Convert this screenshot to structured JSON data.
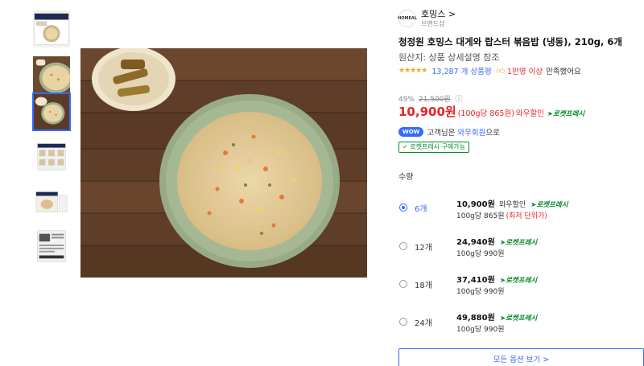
{
  "brand": {
    "name": "호밍스 >",
    "sub": "브랜드샵"
  },
  "product": {
    "title": "청정원 호밍스 대게와 랍스터 볶음밥 (냉동), 210g, 6개",
    "origin": "원산지: 상품 상세설명 참조",
    "rating": {
      "stars": "★★★★★",
      "review_count": "13,287 개 상품평",
      "satisfy_icon": "thumbs-up-icon",
      "satisfy_count": "1만명 이상",
      "satisfy_text": "만족했어요"
    },
    "discount": {
      "percent": "49%",
      "original": "21,500원",
      "info_icon": "ⓘ"
    },
    "price": {
      "main": "10,900원",
      "unit": "(100g당 865원)",
      "wow_label": "와우할인",
      "rocket": "로켓프레시"
    },
    "wow": {
      "badge": "WOW",
      "prefix": "고객님은 ",
      "link": "와우회원",
      "suffix": "으로"
    },
    "fresh_button": "✓ 로켓프레시 구매가능"
  },
  "quantity": {
    "label": "수량",
    "options": [
      {
        "name": "6개",
        "price": "10,900원",
        "wow": "와우할인",
        "rocket": "로켓프레시",
        "unit": "100g당 865원",
        "lowest": "(최저 단위가)",
        "selected": true
      },
      {
        "name": "12개",
        "price": "24,940원",
        "wow": "",
        "rocket": "로켓프레시",
        "unit": "100g당 990원",
        "lowest": "",
        "selected": false
      },
      {
        "name": "18개",
        "price": "37,410원",
        "wow": "",
        "rocket": "로켓프레시",
        "unit": "100g당 990원",
        "lowest": "",
        "selected": false
      },
      {
        "name": "24개",
        "price": "49,880원",
        "wow": "",
        "rocket": "로켓프레시",
        "unit": "100g당 990원",
        "lowest": "",
        "selected": false
      }
    ],
    "all_options": "모든 옵션 보기 >"
  },
  "thumbnails": [
    {
      "name": "thumb-package-front"
    },
    {
      "name": "thumb-fried-rice-closeup"
    },
    {
      "name": "thumb-fried-rice-plate"
    },
    {
      "name": "thumb-package-stack"
    },
    {
      "name": "thumb-package-contents"
    },
    {
      "name": "thumb-package-back"
    }
  ],
  "colors": {
    "accent": "#346aff",
    "price": "#e52528",
    "rocket": "#0a8a2a"
  }
}
